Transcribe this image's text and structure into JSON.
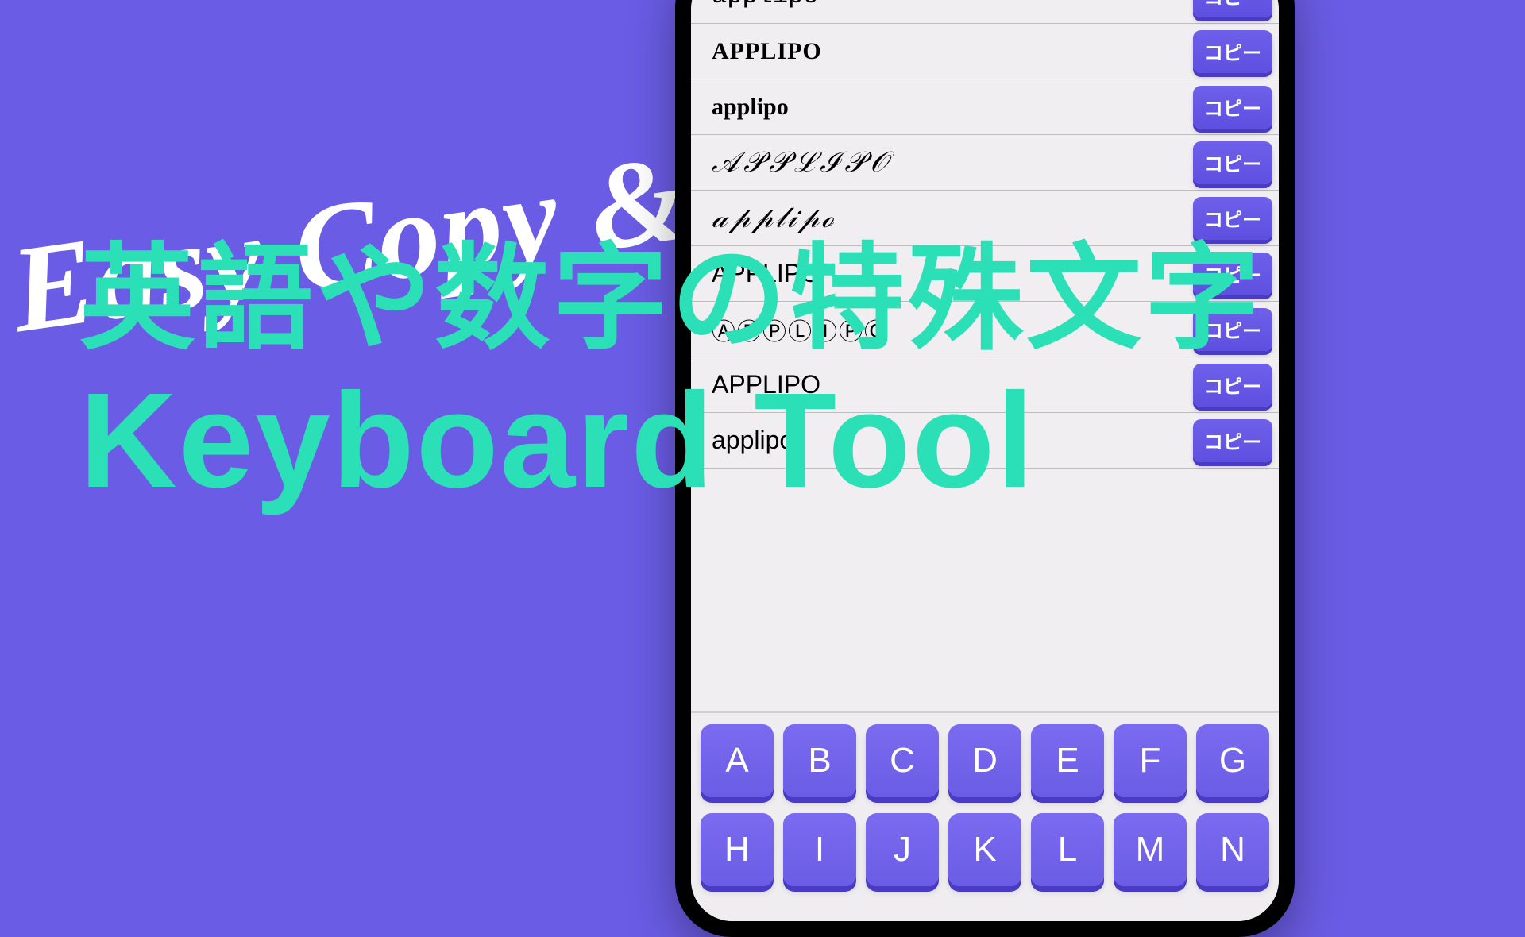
{
  "tagline": "Easy Copy & Paste",
  "heading_jp": "英語や数字の特殊文字",
  "heading_en": "Keyboard Tool",
  "copy_label": "コピー",
  "samples": [
    {
      "text": "applipo",
      "style": "mono"
    },
    {
      "text": "APPLIPO",
      "style": "serifb"
    },
    {
      "text": "applipo",
      "style": "serif"
    },
    {
      "text": "𝒜𝒫𝒫ℒℐ𝒫𝒪",
      "style": "scriptU"
    },
    {
      "text": "𝒶𝓅𝓅𝓁𝒾𝓅ℴ",
      "style": "scriptL"
    },
    {
      "text": "APPLIPO",
      "style": "plain"
    },
    {
      "text": "ⒶⓅⓅⓁⒾⓅⓄ",
      "style": "circled"
    },
    {
      "text": "APPLIPO",
      "style": "plain"
    },
    {
      "text": "applipo",
      "style": "plain"
    }
  ],
  "keyboard_rows": [
    [
      "A",
      "B",
      "C",
      "D",
      "E",
      "F",
      "G"
    ],
    [
      "H",
      "I",
      "J",
      "K",
      "L",
      "M",
      "N"
    ]
  ]
}
